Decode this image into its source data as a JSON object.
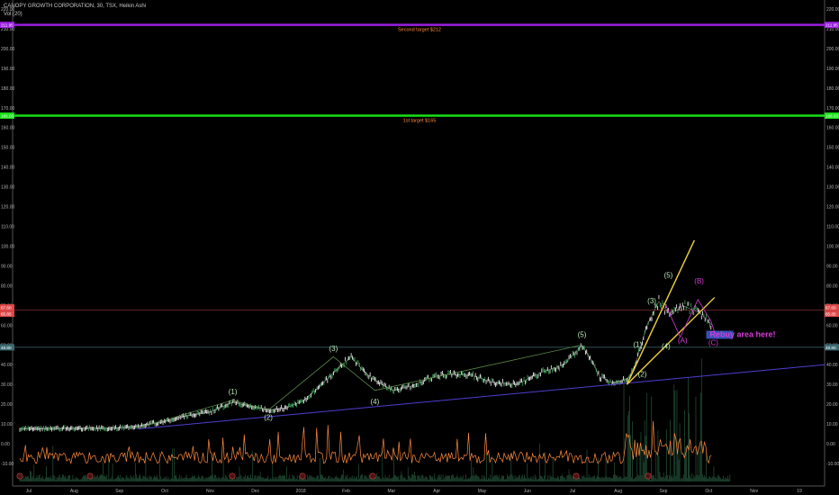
{
  "header": {
    "title": "CANOPY GROWTH CORPORATION, 30, TSX, Heikin Ashi",
    "volume_indicator": "Vol (20)"
  },
  "colors": {
    "background": "#000000",
    "axis_text": "#b4b4b4",
    "price": "#ff8a3d",
    "volume": "#2f6b4a",
    "second_target": "#9b1fe0",
    "first_target": "#18e018",
    "resistance": "#7a2e2e",
    "support": "#3b6b73",
    "trendline": "#4f3fd0",
    "wave_line": "#5a8a4a",
    "wave_label": "#b8e8b8",
    "correction_label": "#d83ad8",
    "wedge": "#f0d040",
    "rebuy_box": "#3b5fd4"
  },
  "chart_data": {
    "type": "line",
    "chart_style": "Heikin Ashi candles with volume oscillator",
    "ylim": [
      -15,
      225
    ],
    "y_ticks": [
      "220.00",
      "210.00",
      "200.00",
      "190.00",
      "180.00",
      "170.00",
      "160.00",
      "150.00",
      "140.00",
      "130.00",
      "120.00",
      "110.00",
      "100.00",
      "90.00",
      "80.00",
      "70.00",
      "60.00",
      "50.00",
      "40.00",
      "30.00",
      "20.00",
      "10.00",
      "0.00",
      "-10.00"
    ],
    "x_ticks": [
      "Jul",
      "Aug",
      "Sep",
      "Oct",
      "Nov",
      "Dec",
      "2018",
      "Feb",
      "Mar",
      "Apr",
      "May",
      "Jun",
      "Jul",
      "Aug",
      "Sep",
      "Oct",
      "Nov",
      "19"
    ],
    "price_axis_labels": {
      "second_target": "211.95",
      "first_target": "166.03",
      "resistance_top": "67.60",
      "resistance_bottom": "65.85",
      "support": "48.80"
    },
    "horizontal_lines": [
      {
        "name": "Second target",
        "label": "Second target   $212",
        "value": 211.95
      },
      {
        "name": "1st target",
        "label": "1st target   $165",
        "value": 166.03
      },
      {
        "name": "resistance",
        "value": 67.6
      },
      {
        "name": "support",
        "value": 48.8
      }
    ],
    "price_series": {
      "t": [
        0,
        4,
        8,
        10,
        12,
        14,
        16,
        18,
        19.5,
        21,
        22.5,
        24,
        25.5,
        26.5,
        28,
        29,
        30,
        31.5,
        33,
        34.5,
        36,
        38,
        40,
        42,
        44,
        46,
        47.5,
        48.5,
        49,
        50,
        51,
        51.3,
        51.5,
        52,
        52.5,
        53,
        53.5,
        54,
        55,
        56,
        57.5,
        58.5
      ],
      "values": [
        7.5,
        7.8,
        7.8,
        9,
        11,
        14,
        16,
        21,
        19,
        17,
        18,
        22,
        30,
        36,
        44,
        37,
        32,
        27,
        29,
        33,
        35,
        35,
        31,
        30,
        36,
        40,
        50,
        40,
        34,
        31,
        32,
        33,
        34,
        40,
        50,
        60,
        66,
        72,
        65,
        70,
        66,
        60
      ]
    },
    "wave_labels": [
      {
        "text": "(1)",
        "t": 18,
        "v": 25
      },
      {
        "text": "(2)",
        "t": 21,
        "v": 12
      },
      {
        "text": "(3)",
        "t": 26.5,
        "v": 47
      },
      {
        "text": "(4)",
        "t": 30,
        "v": 20
      },
      {
        "text": "(5)",
        "t": 47.5,
        "v": 54
      },
      {
        "text": "(1)",
        "t": 52.2,
        "v": 49
      },
      {
        "text": "(2)",
        "t": 52.6,
        "v": 34
      },
      {
        "text": "(3)",
        "t": 53.4,
        "v": 71
      },
      {
        "text": "(4)",
        "t": 54.6,
        "v": 48
      },
      {
        "text": "(5)",
        "t": 54.8,
        "v": 84
      }
    ],
    "correction_labels": [
      {
        "text": "(A)",
        "t": 56.0,
        "v": 51
      },
      {
        "text": "(B)",
        "t": 57.4,
        "v": 81
      },
      {
        "text": "(C)",
        "t": 58.6,
        "v": 50
      }
    ],
    "annotation": {
      "text": "Rebuy area here!",
      "t": 60.5,
      "v": 54
    }
  }
}
